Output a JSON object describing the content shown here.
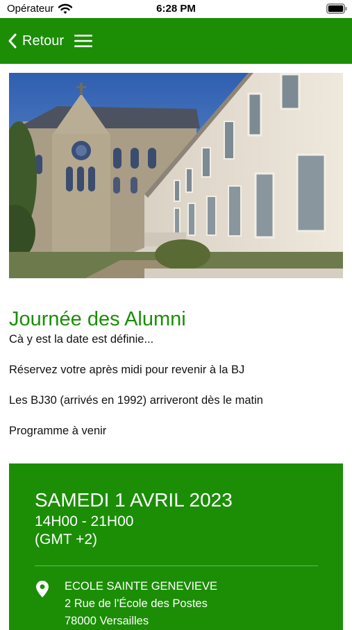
{
  "status_bar": {
    "carrier": "Opérateur",
    "time": "6:28 PM",
    "icons": [
      "wifi-icon",
      "battery-icon"
    ]
  },
  "nav": {
    "back_label": "Retour",
    "icons": [
      "chevron-left-icon",
      "hamburger-menu-icon"
    ],
    "background_color": "#1b8e05"
  },
  "hero": {
    "subject": "school-building-photo"
  },
  "article": {
    "title": "Journée des Alumni",
    "lines": [
      "Cà y est la date est définie...",
      "Réservez votre après midi pour revenir à la BJ",
      "Les BJ30 (arrivés en 1992) arriveront dès le matin",
      "Programme à venir"
    ],
    "title_color": "#1b8e05"
  },
  "event": {
    "date": "SAMEDI 1 AVRIL 2023",
    "time": "14H00 - 21H00",
    "timezone": "(GMT +2)",
    "location": {
      "icon": "location-pin-icon",
      "name": "ECOLE SAINTE GENEVIEVE",
      "street": "2 Rue de l'École des Postes",
      "city": "78000 Versailles"
    },
    "card_color": "#1b8e05"
  }
}
